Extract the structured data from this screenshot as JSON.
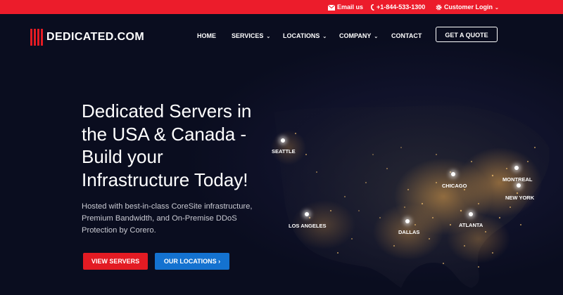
{
  "topbar": {
    "email_label": "Email us",
    "phone": "+1-844-533-1300",
    "login_label": "Customer Login"
  },
  "brand": {
    "name": "DEDICATED.COM"
  },
  "nav": {
    "home": "HOME",
    "services": "SERVICES",
    "locations": "LOCATIONS",
    "company": "COMPANY",
    "contact": "CONTACT",
    "quote": "GET A QUOTE"
  },
  "hero": {
    "headline_lines": [
      "Dedicated Servers in",
      "the USA & Canada -",
      "Build your",
      "Infrastructure Today!"
    ],
    "subtext": "Hosted with best-in-class CoreSite infrastructure, Premium Bandwidth, and On-Premise DDoS Protection by Corero.",
    "view_servers": "VIEW SERVERS",
    "our_locations": "OUR LOCATIONS ›"
  },
  "map": {
    "cities": [
      "SEATTLE",
      "LOS ANGELES",
      "DALLAS",
      "CHICAGO",
      "ATLANTA",
      "MONTREAL",
      "NEW YORK"
    ]
  },
  "colors": {
    "topbar": "#ec1c2b",
    "red_button": "#e31b23",
    "blue_button": "#1472d0",
    "background": "#0a0d1f"
  }
}
